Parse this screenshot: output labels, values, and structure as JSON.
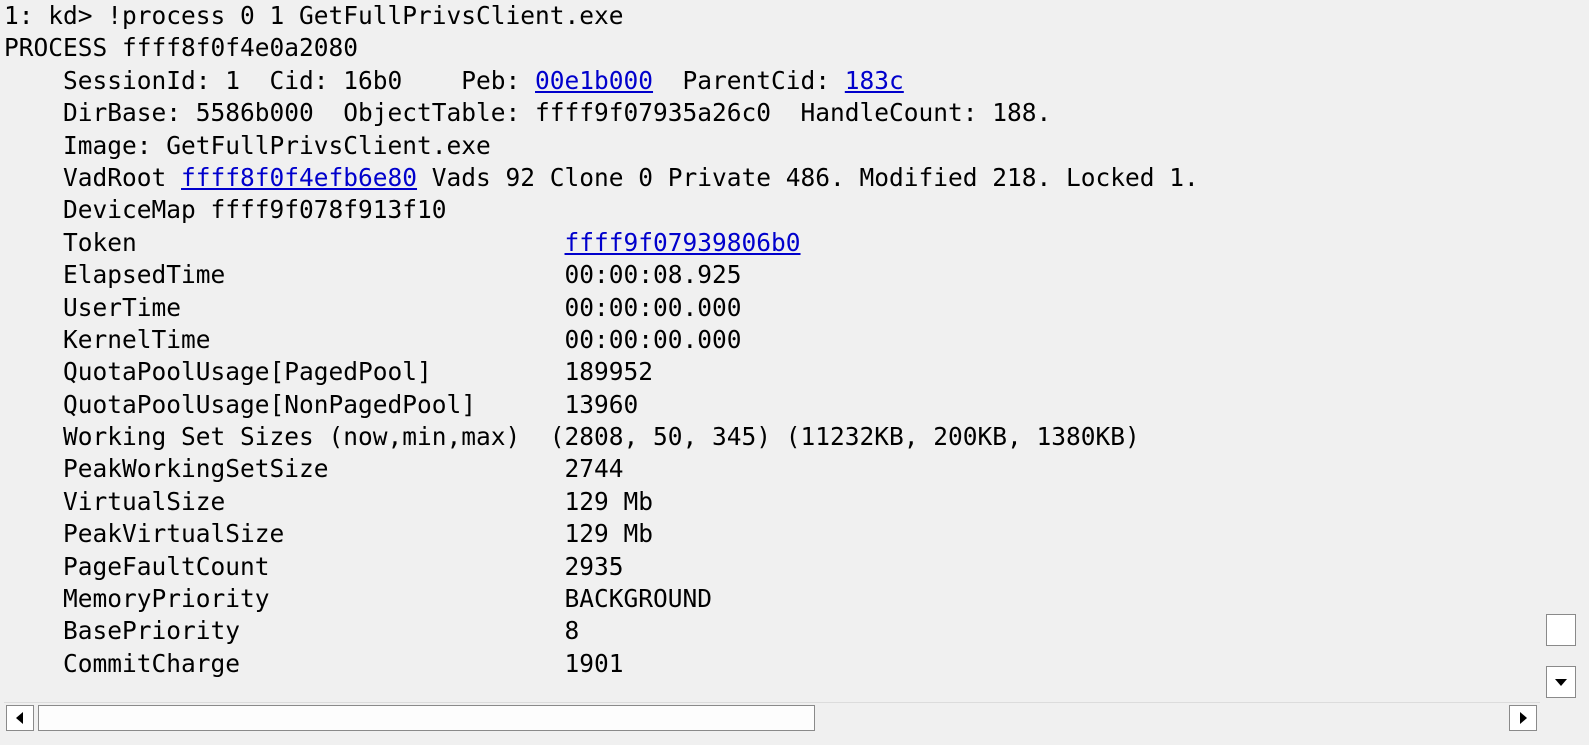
{
  "console": {
    "l1": "1: kd> !process 0 1 GetFullPrivsClient.exe",
    "l2": "PROCESS ffff8f0f4e0a2080",
    "l3a": "    SessionId: 1  Cid: 16b0    Peb: ",
    "l3_peb": "00e1b000",
    "l3b": "  ParentCid: ",
    "l3_parent": "183c",
    "l4": "    DirBase: 5586b000  ObjectTable: ffff9f07935a26c0  HandleCount: 188.",
    "l5": "    Image: GetFullPrivsClient.exe",
    "l6a": "    VadRoot ",
    "l6_vad": "ffff8f0f4efb6e80",
    "l6b": " Vads 92 Clone 0 Private 486. Modified 218. Locked 1.",
    "l7": "    DeviceMap ffff9f078f913f10",
    "l8a": "    Token                             ",
    "l8_token": "ffff9f07939806b0",
    "l9": "    ElapsedTime                       00:00:08.925",
    "l10": "    UserTime                          00:00:00.000",
    "l11": "    KernelTime                        00:00:00.000",
    "l12": "    QuotaPoolUsage[PagedPool]         189952",
    "l13": "    QuotaPoolUsage[NonPagedPool]      13960",
    "l14": "    Working Set Sizes (now,min,max)  (2808, 50, 345) (11232KB, 200KB, 1380KB)",
    "l15": "    PeakWorkingSetSize                2744",
    "l16": "    VirtualSize                       129 Mb",
    "l17": "    PeakVirtualSize                   129 Mb",
    "l18": "    PageFaultCount                    2935",
    "l19": "    MemoryPriority                    BACKGROUND",
    "l20": "    BasePriority                      8",
    "l21": "    CommitCharge                      1901"
  },
  "scrollbar": {
    "left_arrow_icon": "triangle-left",
    "right_arrow_icon": "triangle-right",
    "down_arrow_icon": "triangle-down"
  }
}
